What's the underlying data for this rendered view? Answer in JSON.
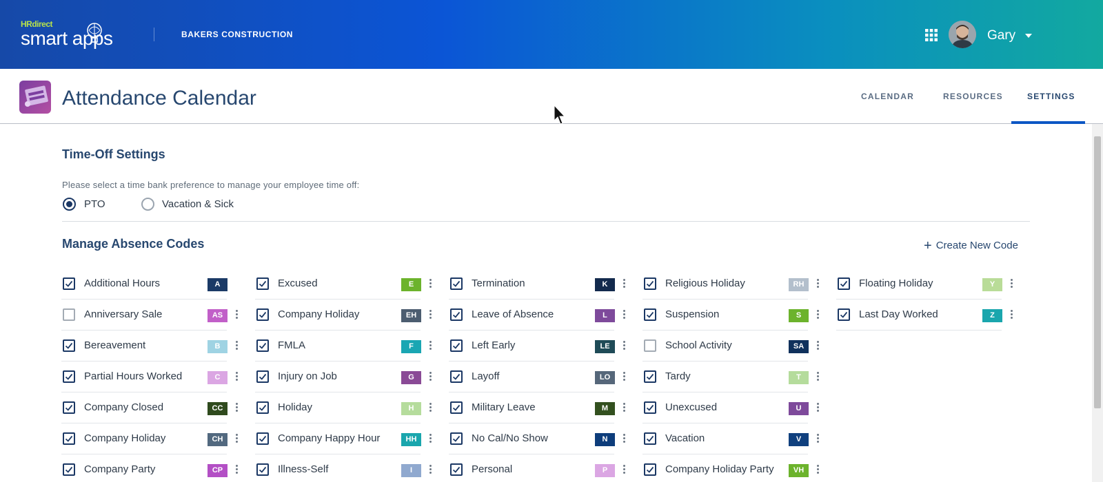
{
  "header": {
    "brand_prefix": "HRdirect",
    "brand_name": "smart apps",
    "company": "BAKERS CONSTRUCTION",
    "user_name": "Gary",
    "apps_icon": "grid-apps-icon",
    "colors": {
      "gradient_start": "#1649a8",
      "gradient_end": "#12a9a0"
    }
  },
  "app": {
    "title": "Attendance Calendar",
    "tabs": [
      {
        "label": "CALENDAR",
        "active": false
      },
      {
        "label": "RESOURCES",
        "active": false
      },
      {
        "label": "SETTINGS",
        "active": true
      }
    ]
  },
  "time_off": {
    "title": "Time-Off Settings",
    "helper": "Please select a time bank preference to manage your employee time off:",
    "options": [
      {
        "label": "PTO",
        "selected": true
      },
      {
        "label": "Vacation & Sick",
        "selected": false
      }
    ]
  },
  "absence": {
    "title": "Manage Absence Codes",
    "create_label": "Create New Code",
    "columns": [
      [
        {
          "label": "Additional Hours",
          "code": "A",
          "color": "#1b3a66",
          "checked": true,
          "menu": false
        },
        {
          "label": "Anniversary Sale",
          "code": "AS",
          "color": "#c15fc8",
          "checked": false,
          "menu": true
        },
        {
          "label": "Bereavement",
          "code": "B",
          "color": "#9fd3e3",
          "checked": true,
          "menu": true
        },
        {
          "label": "Partial Hours Worked",
          "code": "C",
          "color": "#dba6e3",
          "checked": true,
          "menu": true
        },
        {
          "label": "Company Closed",
          "code": "CC",
          "color": "#2f4a1d",
          "checked": true,
          "menu": true
        },
        {
          "label": "Company Holiday",
          "code": "CH",
          "color": "#52697f",
          "checked": true,
          "menu": true
        },
        {
          "label": "Company Party",
          "code": "CP",
          "color": "#b34fc5",
          "checked": true,
          "menu": true
        }
      ],
      [
        {
          "label": "Excused",
          "code": "E",
          "color": "#6cb32c",
          "checked": true,
          "menu": true
        },
        {
          "label": "Company Holiday",
          "code": "EH",
          "color": "#4c5d70",
          "checked": true,
          "menu": true
        },
        {
          "label": "FMLA",
          "code": "F",
          "color": "#1aa6b3",
          "checked": true,
          "menu": true
        },
        {
          "label": "Injury on Job",
          "code": "G",
          "color": "#8a4a96",
          "checked": true,
          "menu": true
        },
        {
          "label": "Holiday",
          "code": "H",
          "color": "#b5dc9c",
          "checked": true,
          "menu": true
        },
        {
          "label": "Company Happy Hour",
          "code": "HH",
          "color": "#1aa6ad",
          "checked": true,
          "menu": true
        },
        {
          "label": "Illness-Self",
          "code": "I",
          "color": "#90a9cf",
          "checked": true,
          "menu": true
        }
      ],
      [
        {
          "label": "Termination",
          "code": "K",
          "color": "#132a4d",
          "checked": true,
          "menu": true
        },
        {
          "label": "Leave of Absence",
          "code": "L",
          "color": "#7e4a9b",
          "checked": true,
          "menu": true
        },
        {
          "label": "Left Early",
          "code": "LE",
          "color": "#1f4b57",
          "checked": true,
          "menu": true
        },
        {
          "label": "Layoff",
          "code": "LO",
          "color": "#56677a",
          "checked": true,
          "menu": true
        },
        {
          "label": "Military Leave",
          "code": "M",
          "color": "#33501f",
          "checked": true,
          "menu": true
        },
        {
          "label": "No Cal/No Show",
          "code": "N",
          "color": "#0e3d7b",
          "checked": true,
          "menu": true
        },
        {
          "label": "Personal",
          "code": "P",
          "color": "#dba6e3",
          "checked": true,
          "menu": true
        }
      ],
      [
        {
          "label": "Religious Holiday",
          "code": "RH",
          "color": "#b3bfcc",
          "checked": true,
          "menu": true
        },
        {
          "label": "Suspension",
          "code": "S",
          "color": "#6cb32c",
          "checked": true,
          "menu": true
        },
        {
          "label": "School Activity",
          "code": "SA",
          "color": "#10315c",
          "checked": false,
          "menu": true
        },
        {
          "label": "Tardy",
          "code": "T",
          "color": "#b5dc9c",
          "checked": true,
          "menu": true
        },
        {
          "label": "Unexcused",
          "code": "U",
          "color": "#7e4a9b",
          "checked": true,
          "menu": true
        },
        {
          "label": "Vacation",
          "code": "V",
          "color": "#10407e",
          "checked": true,
          "menu": true
        },
        {
          "label": "Company Holiday Party",
          "code": "VH",
          "color": "#6cb32c",
          "checked": true,
          "menu": true
        }
      ],
      [
        {
          "label": "Floating Holiday",
          "code": "Y",
          "color": "#b9dc98",
          "checked": true,
          "menu": true
        },
        {
          "label": "Last Day Worked",
          "code": "Z",
          "color": "#1aa6ad",
          "checked": true,
          "menu": true
        }
      ]
    ]
  }
}
